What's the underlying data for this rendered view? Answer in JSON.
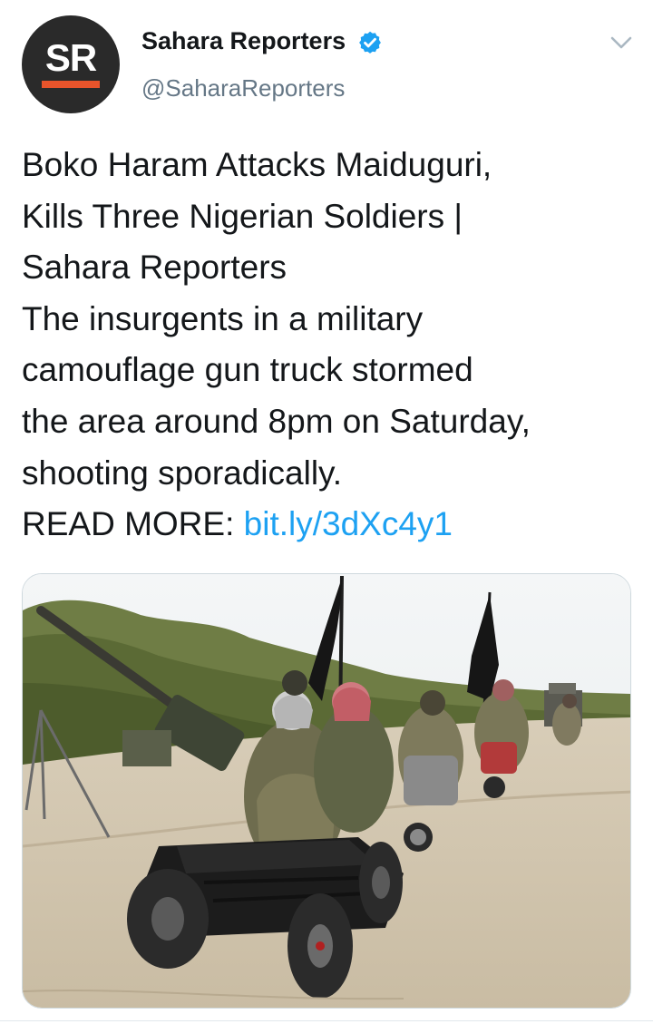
{
  "tweet": {
    "author": {
      "avatar_initials": "SR",
      "display_name": "Sahara Reporters",
      "handle": "@SaharaReporters",
      "verified": true
    },
    "text_lines": [
      "Boko Haram Attacks Maiduguri,",
      "Kills Three Nigerian Soldiers |",
      "Sahara Reporters",
      "The insurgents in a military",
      "camouflage gun truck stormed",
      "the area around 8pm on Saturday,",
      "shooting sporadically."
    ],
    "read_more_label": "READ MORE:",
    "link_text": "bit.ly/3dXc4y1",
    "media": {
      "description_icon": "photo-icon"
    }
  },
  "colors": {
    "link": "#1da1f2",
    "verified": "#1da1f2",
    "avatar_bg": "#2a2a2a",
    "avatar_bar": "#e8542b",
    "secondary_text": "#657786"
  },
  "icons": {
    "verified": "verified-badge-icon",
    "menu": "chevron-down-icon"
  }
}
